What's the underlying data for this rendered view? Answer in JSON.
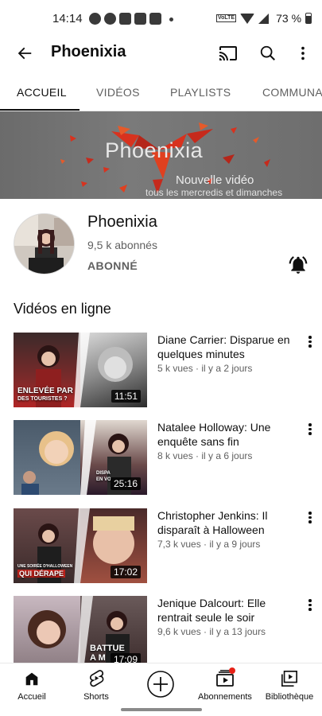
{
  "status_bar": {
    "time": "14:14",
    "battery": "73 %"
  },
  "header": {
    "title": "Phoenixia"
  },
  "tabs": [
    {
      "label": "ACCUEIL",
      "active": true
    },
    {
      "label": "VIDÉOS",
      "active": false
    },
    {
      "label": "PLAYLISTS",
      "active": false
    },
    {
      "label": "COMMUNA",
      "active": false
    }
  ],
  "banner": {
    "title": "Phoenixia",
    "subtitle": "Nouvelle vidéo",
    "schedule": "tous les mercredis et dimanches"
  },
  "channel": {
    "name": "Phoenixia",
    "subscribers": "9,5 k abonnés",
    "subscribed_label": "ABONNÉ"
  },
  "section": {
    "title": "Vidéos en ligne"
  },
  "videos": [
    {
      "title": "Diane Carrier: Disparue en quelques minutes",
      "meta": "5 k vues · il y a 2 jours",
      "duration": "11:51",
      "caption_line1": "ENLEVÉE PAR",
      "caption_line2": "DES TOURISTES ?"
    },
    {
      "title": "Natalee Holloway: Une enquête sans fin",
      "meta": "8 k vues · il y a 6 jours",
      "duration": "25:16",
      "caption_line1": "DISPA",
      "caption_line2": "EN VO"
    },
    {
      "title": "Christopher Jenkins: Il disparaît à Halloween",
      "meta": "7,3 k vues · il y a 9 jours",
      "duration": "17:02",
      "caption_line1": "UNE SOIRÉE D'HALLOWEEN",
      "caption_line2": "QUI DÉRAPE"
    },
    {
      "title": "Jenique Dalcourt: Elle rentrait seule le soir",
      "meta": "9,6 k vues · il y a 13 jours",
      "duration": "17:09",
      "caption_line1": "BATTUE",
      "caption_line2": "A M"
    }
  ],
  "bottom_nav": [
    {
      "label": "Accueil",
      "icon": "home-icon"
    },
    {
      "label": "Shorts",
      "icon": "shorts-icon"
    },
    {
      "label": "",
      "icon": "create-icon"
    },
    {
      "label": "Abonnements",
      "icon": "subscriptions-icon"
    },
    {
      "label": "Bibliothèque",
      "icon": "library-icon"
    }
  ],
  "colors": {
    "accent": "#cc2a2a",
    "banner_red": "#d8321e",
    "notification_dot": "#e62117"
  }
}
